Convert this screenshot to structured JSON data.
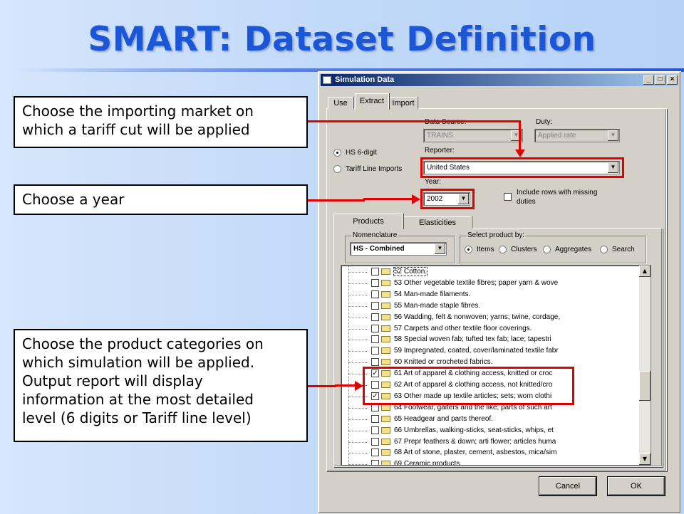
{
  "slide": {
    "title": "SMART: Dataset Definition"
  },
  "callouts": {
    "market": [
      "Choose the importing market on",
      "which a tariff cut will be applied"
    ],
    "year": [
      "Choose a year"
    ],
    "products": [
      "Choose the product categories on",
      "which simulation will be applied.",
      "Output report will display",
      "information at the most detailed",
      "level (6 digits or Tariff line level)"
    ]
  },
  "dialog": {
    "title": "Simulation Data",
    "tabs": [
      "Use",
      "Extract",
      "Import"
    ],
    "data_source_label": "Data Source:",
    "data_source_value": "TRAINS",
    "duty_label": "Duty:",
    "duty_value": "Applied rate",
    "radio_hs": "HS 6-digit",
    "radio_tariff": "Tariff Line Imports",
    "reporter_label": "Reporter:",
    "reporter_value": "United States",
    "year_label": "Year:",
    "year_value": "2002",
    "missing_rows_line1": "Include rows with missing",
    "missing_rows_line2": "duties",
    "subtabs": [
      "Products",
      "Elasticities"
    ],
    "nomenclature_label": "Nomenclature",
    "nomenclature_value": "HS - Combined",
    "select_by_label": "Select product by:",
    "select_options": [
      "Items",
      "Clusters",
      "Aggregates",
      "Search"
    ],
    "cancel": "Cancel",
    "ok": "OK"
  },
  "tree_items": [
    {
      "code": "52",
      "text": "Cotton.",
      "checked": false,
      "selected": true
    },
    {
      "code": "53",
      "text": "Other vegetable textile fibres; paper  yarn & wove",
      "checked": false
    },
    {
      "code": "54",
      "text": "Man-made filaments.",
      "checked": false
    },
    {
      "code": "55",
      "text": "Man-made staple fibres.",
      "checked": false
    },
    {
      "code": "56",
      "text": "Wadding, felt & nonwoven; yarns; twine,  cordage,",
      "checked": false
    },
    {
      "code": "57",
      "text": "Carpets and other textile floor  coverings.",
      "checked": false
    },
    {
      "code": "58",
      "text": "Special woven fab; tufted tex fab; lace;  tapestri",
      "checked": false
    },
    {
      "code": "59",
      "text": "Impregnated, coated, cover/laminated  textile fabr",
      "checked": false
    },
    {
      "code": "60",
      "text": "Knitted or crocheted fabrics.",
      "checked": false
    },
    {
      "code": "61",
      "text": "Art of apparel & clothing access,  knitted or croc",
      "checked": true
    },
    {
      "code": "62",
      "text": "Art of apparel & clothing access,  not  knitted/cro",
      "checked": false
    },
    {
      "code": "63",
      "text": "Other made up textile articles; sets;  worn clothi",
      "checked": true
    },
    {
      "code": "64",
      "text": "Footwear, gaiters and the like; parts of  such art",
      "checked": false
    },
    {
      "code": "65",
      "text": "Headgear and parts thereof.",
      "checked": false
    },
    {
      "code": "66",
      "text": "Umbrellas, walking-sticks, seat-sticks,  whips, et",
      "checked": false
    },
    {
      "code": "67",
      "text": "Prepr feathers & down; arti flower;  articles huma",
      "checked": false
    },
    {
      "code": "68",
      "text": "Art of stone, plaster, cement, asbestos,  mica/sim",
      "checked": false
    },
    {
      "code": "69",
      "text": "Ceramic products.",
      "checked": false
    }
  ]
}
